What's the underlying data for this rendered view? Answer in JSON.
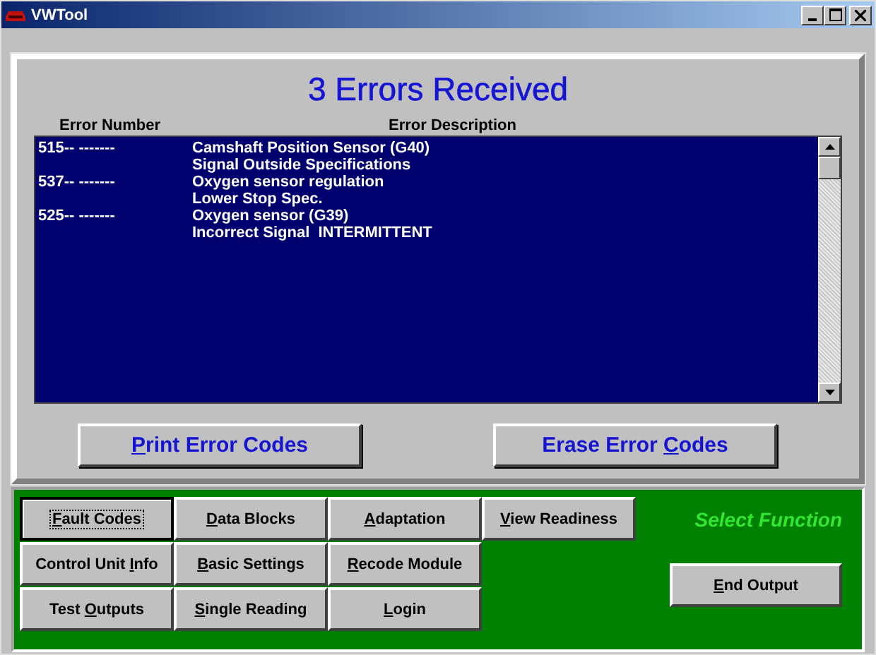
{
  "window": {
    "title": "VWTool"
  },
  "heading": "3 Errors Received",
  "columns": [
    "Error Number",
    "Error Description"
  ],
  "errors": [
    {
      "number": "515-- -------",
      "description": [
        "Camshaft Position Sensor (G40)",
        "Signal Outside Specifications"
      ]
    },
    {
      "number": "537-- -------",
      "description": [
        "Oxygen sensor regulation",
        "Lower Stop Spec."
      ]
    },
    {
      "number": "525-- -------",
      "description": [
        "Oxygen sensor (G39)",
        "Incorrect Signal  INTERMITTENT"
      ]
    }
  ],
  "actions": [
    {
      "label": {
        "hotkey": "P",
        "after": "rint Error Codes"
      }
    },
    {
      "label": {
        "before": "Erase Error ",
        "hotkey": "C",
        "after": "odes"
      }
    }
  ],
  "function_rows": [
    [
      {
        "label": {
          "hotkey": "F",
          "after": "ault Codes"
        },
        "selected": true
      },
      {
        "label": {
          "hotkey": "D",
          "after": "ata Blocks"
        },
        "selected": false
      },
      {
        "label": {
          "hotkey": "A",
          "after": "daptation"
        },
        "selected": false
      },
      {
        "label": {
          "hotkey": "V",
          "after": "iew Readiness"
        },
        "selected": false
      }
    ],
    [
      {
        "label": {
          "before": "Control Unit ",
          "hotkey": "I",
          "after": "nfo"
        },
        "selected": false
      },
      {
        "label": {
          "hotkey": "B",
          "after": "asic Settings"
        },
        "selected": false
      },
      {
        "label": {
          "hotkey": "R",
          "after": "ecode Module"
        },
        "selected": false
      }
    ],
    [
      {
        "label": {
          "before": "Test ",
          "hotkey": "O",
          "after": "utputs"
        },
        "selected": false
      },
      {
        "label": {
          "hotkey": "S",
          "after": "ingle Reading"
        },
        "selected": false
      },
      {
        "label": {
          "hotkey": "L",
          "after": "ogin"
        },
        "selected": false
      }
    ]
  ],
  "select_function": "Select Function",
  "end_button": {
    "label": {
      "hotkey": "E",
      "after": "nd Output"
    }
  }
}
